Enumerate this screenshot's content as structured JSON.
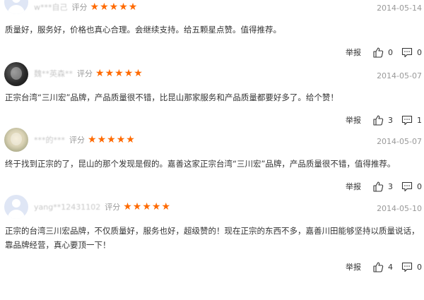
{
  "reviews": [
    {
      "username": "w***自己",
      "rating_label": "评分",
      "stars": 5,
      "date": "2014-05-14",
      "text": "质量好，服务好，价格也真心合理。会继续支持。给五颗星点赞。值得推荐。",
      "report_label": "举报",
      "like_count": "0",
      "comment_count": "0",
      "avatar": "default-avatar"
    },
    {
      "username": "魏**英森**",
      "rating_label": "评分",
      "stars": 5,
      "date": "2014-05-07",
      "text": "正宗台湾“三川宏”品牌，产品质量很不错，比昆山那家服务和产品质量都要好多了。给个赞！",
      "report_label": "举报",
      "like_count": "3",
      "comment_count": "1",
      "avatar": "photo-avatar"
    },
    {
      "username": "***的***",
      "rating_label": "评分",
      "stars": 5,
      "date": "2014-05-07",
      "text": "终于找到正宗的了，昆山的那个发现是假的。嘉善这家正宗台湾“三川宏”品牌，产品质量很不错，值得推荐。",
      "report_label": "举报",
      "like_count": "3",
      "comment_count": "0",
      "avatar": "photo-avatar"
    },
    {
      "username": "yang**12431102",
      "rating_label": "评分",
      "stars": 5,
      "date": "2014-05-10",
      "text": "正宗的台湾三川宏品牌，不仅质量好，服务也好，超级赞的！现在正宗的东西不多，嘉善川田能够坚持以质量说话，靠品牌经营，真心要顶一下！",
      "report_label": "举报",
      "like_count": "4",
      "comment_count": "0",
      "avatar": "default-avatar"
    }
  ]
}
